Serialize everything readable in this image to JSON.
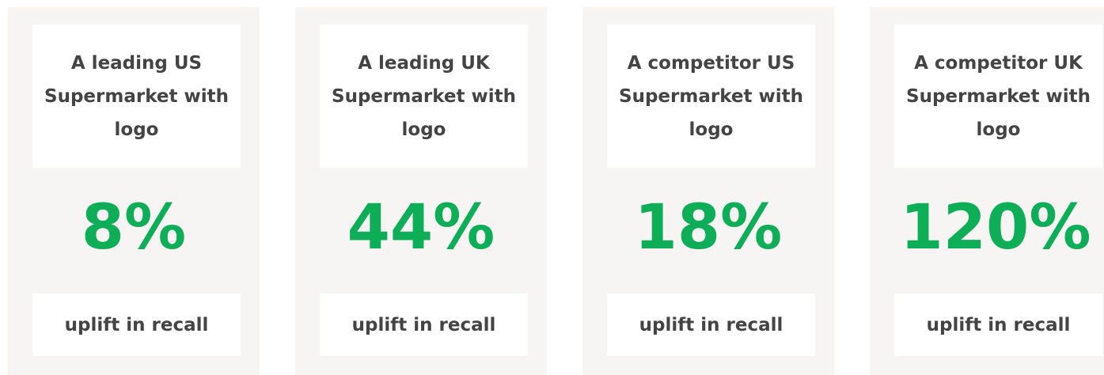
{
  "accent_color": "#0ead57",
  "text_color": "#444444",
  "card_bg_color": "#f6f5f3",
  "cards": [
    {
      "title": "A leading US Supermarket with logo",
      "stat": "8%",
      "caption": "uplift in recall"
    },
    {
      "title": "A leading UK Supermarket with logo",
      "stat": "44%",
      "caption": "uplift in recall"
    },
    {
      "title": "A competitor US Supermarket with logo",
      "stat": "18%",
      "caption": "uplift in recall"
    },
    {
      "title": "A competitor UK Supermarket with logo",
      "stat": "120%",
      "caption": "uplift in recall"
    }
  ]
}
